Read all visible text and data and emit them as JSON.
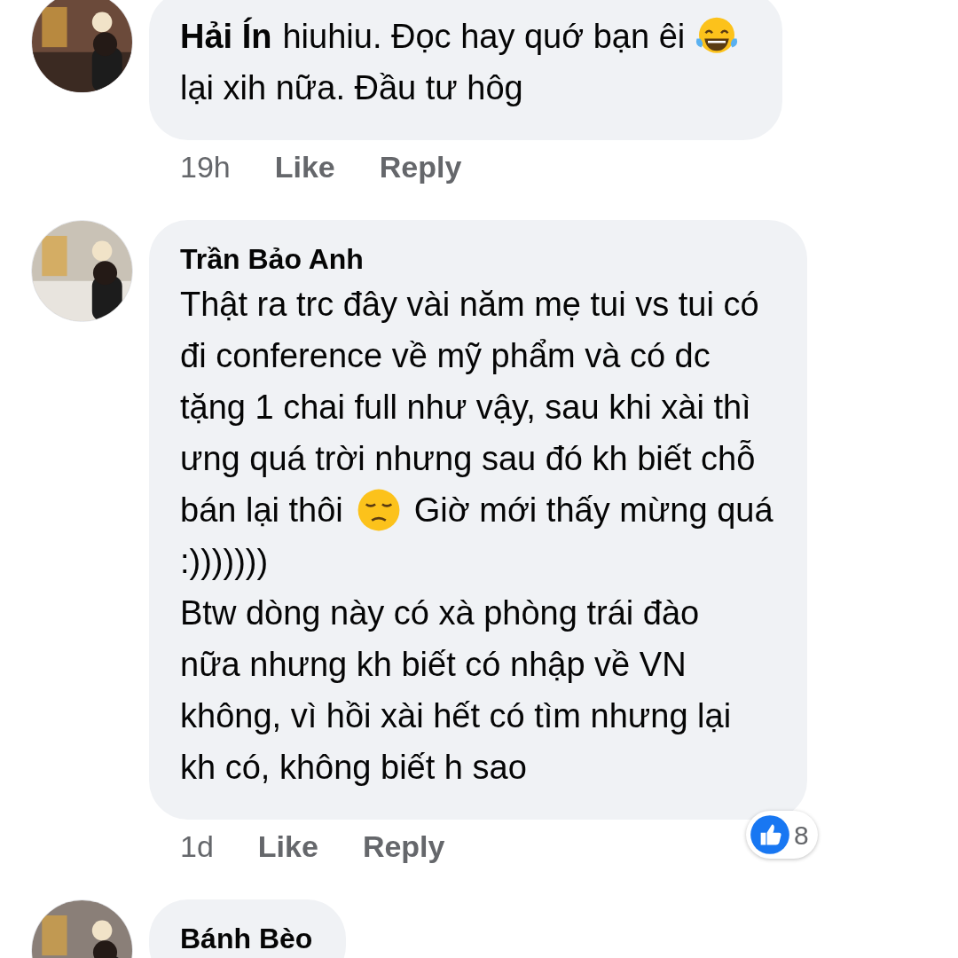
{
  "comments": [
    {
      "author": "Hải Ín",
      "author_inline": true,
      "lines": [
        [
          {
            "kind": "text",
            "text": "hiuhiu. Đọc hay quớ bạn êi"
          },
          {
            "kind": "laughing"
          }
        ],
        [
          {
            "kind": "text",
            "text": "lại xih nữa. Đầu tư hôg"
          }
        ]
      ],
      "time": "19h",
      "actions": [
        "Like",
        "Reply"
      ]
    },
    {
      "author": "Trần Bảo Anh",
      "author_inline": false,
      "lines": [
        [
          {
            "kind": "text",
            "text": "Thật ra trc đây vài năm mẹ tui vs tui có"
          }
        ],
        [
          {
            "kind": "text",
            "text": "đi conference về mỹ phẩm và có dc"
          }
        ],
        [
          {
            "kind": "text",
            "text": "tặng 1 chai full như vậy, sau khi xài thì"
          }
        ],
        [
          {
            "kind": "text",
            "text": "ưng quá trời nhưng sau đó kh biết chỗ"
          }
        ],
        [
          {
            "kind": "text",
            "text": "bán lại thôi"
          },
          {
            "kind": "sad"
          },
          {
            "kind": "text",
            "text": "Giờ mới thấy mừng quá"
          }
        ],
        [
          {
            "kind": "text",
            "text": ":)))))))"
          }
        ],
        [
          {
            "kind": "text",
            "text": "Btw dòng này có xà phòng trái đào"
          }
        ],
        [
          {
            "kind": "text",
            "text": "nữa nhưng kh biết có nhập về VN"
          }
        ],
        [
          {
            "kind": "text",
            "text": "không, vì hồi xài hết có tìm nhưng lại"
          }
        ],
        [
          {
            "kind": "text",
            "text": "kh có, không biết h sao"
          }
        ]
      ],
      "reactions": {
        "count": "8"
      },
      "time": "1d",
      "actions": [
        "Like",
        "Reply"
      ]
    },
    {
      "author": "Bánh Bèo",
      "author_inline": false
    }
  ]
}
